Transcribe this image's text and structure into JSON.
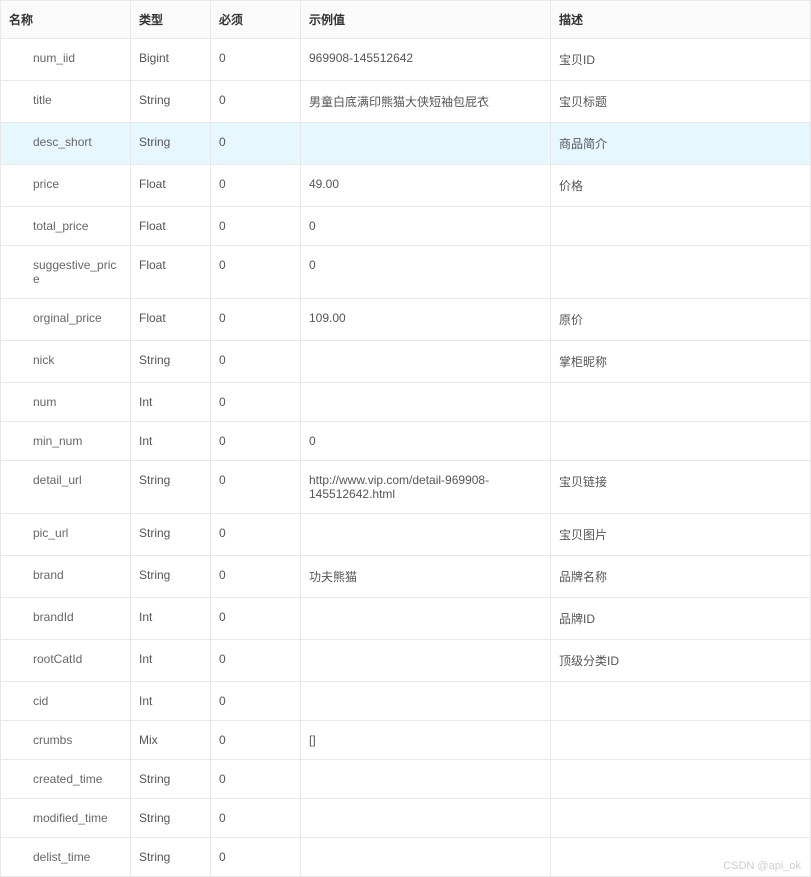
{
  "headers": {
    "name": "名称",
    "type": "类型",
    "required": "必须",
    "example": "示例值",
    "description": "描述"
  },
  "rows": [
    {
      "name": "num_iid",
      "type": "Bigint",
      "required": "0",
      "example": "969908-145512642",
      "description": "宝贝ID",
      "highlight": false
    },
    {
      "name": "title",
      "type": "String",
      "required": "0",
      "example": "男童白底满印熊猫大侠短袖包屁衣",
      "description": "宝贝标题",
      "highlight": false
    },
    {
      "name": "desc_short",
      "type": "String",
      "required": "0",
      "example": "",
      "description": "商品简介",
      "highlight": true
    },
    {
      "name": "price",
      "type": "Float",
      "required": "0",
      "example": "49.00",
      "description": "价格",
      "highlight": false
    },
    {
      "name": "total_price",
      "type": "Float",
      "required": "0",
      "example": "0",
      "description": "",
      "highlight": false
    },
    {
      "name": "suggestive_price",
      "type": "Float",
      "required": "0",
      "example": "0",
      "description": "",
      "highlight": false
    },
    {
      "name": "orginal_price",
      "type": "Float",
      "required": "0",
      "example": "109.00",
      "description": "原价",
      "highlight": false
    },
    {
      "name": "nick",
      "type": "String",
      "required": "0",
      "example": "",
      "description": "掌柜昵称",
      "highlight": false
    },
    {
      "name": "num",
      "type": "Int",
      "required": "0",
      "example": "",
      "description": "",
      "highlight": false
    },
    {
      "name": "min_num",
      "type": "Int",
      "required": "0",
      "example": "0",
      "description": "",
      "highlight": false
    },
    {
      "name": "detail_url",
      "type": "String",
      "required": "0",
      "example": "http://www.vip.com/detail-969908-145512642.html",
      "description": "宝贝链接",
      "highlight": false
    },
    {
      "name": "pic_url",
      "type": "String",
      "required": "0",
      "example": "",
      "description": "宝贝图片",
      "highlight": false
    },
    {
      "name": "brand",
      "type": "String",
      "required": "0",
      "example": "功夫熊猫",
      "description": "品牌名称",
      "highlight": false
    },
    {
      "name": "brandId",
      "type": "Int",
      "required": "0",
      "example": "",
      "description": "品牌ID",
      "highlight": false
    },
    {
      "name": "rootCatId",
      "type": "Int",
      "required": "0",
      "example": "",
      "description": "顶级分类ID",
      "highlight": false
    },
    {
      "name": "cid",
      "type": "Int",
      "required": "0",
      "example": "",
      "description": "",
      "highlight": false
    },
    {
      "name": "crumbs",
      "type": "Mix",
      "required": "0",
      "example": "[]",
      "description": "",
      "highlight": false
    },
    {
      "name": "created_time",
      "type": "String",
      "required": "0",
      "example": "",
      "description": "",
      "highlight": false
    },
    {
      "name": "modified_time",
      "type": "String",
      "required": "0",
      "example": "",
      "description": "",
      "highlight": false
    },
    {
      "name": "delist_time",
      "type": "String",
      "required": "0",
      "example": "",
      "description": "",
      "highlight": false
    }
  ],
  "watermark": "CSDN @api_ok"
}
